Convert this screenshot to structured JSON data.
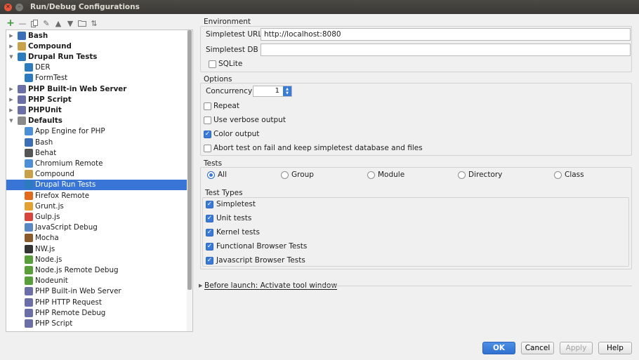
{
  "window": {
    "title": "Run/Debug Configurations"
  },
  "toolbar": {
    "icons": [
      "add-icon",
      "remove-icon",
      "copy-icon",
      "wrench-icon",
      "move-up-icon",
      "move-down-icon",
      "folder-icon",
      "sort-icon"
    ]
  },
  "tree": {
    "items": [
      {
        "label": "Bash",
        "level": 0,
        "arrow": "▶",
        "bold": true,
        "icon": "bash-icon",
        "color": "#3b6fb6"
      },
      {
        "label": "Compound",
        "level": 0,
        "arrow": "▶",
        "bold": true,
        "icon": "compound-icon",
        "color": "#c7a24a"
      },
      {
        "label": "Drupal Run Tests",
        "level": 0,
        "arrow": "▼",
        "bold": true,
        "icon": "drupal-icon",
        "color": "#2c7bbf"
      },
      {
        "label": "DER",
        "level": 1,
        "arrow": "",
        "bold": false,
        "icon": "drupal-icon",
        "color": "#2c7bbf"
      },
      {
        "label": "FormTest",
        "level": 1,
        "arrow": "",
        "bold": false,
        "icon": "drupal-icon",
        "color": "#2c7bbf"
      },
      {
        "label": "PHP Built-in Web Server",
        "level": 0,
        "arrow": "▶",
        "bold": true,
        "icon": "php-server-icon",
        "color": "#6a6fa8"
      },
      {
        "label": "PHP Script",
        "level": 0,
        "arrow": "▶",
        "bold": true,
        "icon": "php-script-icon",
        "color": "#6a6fa8"
      },
      {
        "label": "PHPUnit",
        "level": 0,
        "arrow": "▶",
        "bold": true,
        "icon": "phpunit-icon",
        "color": "#6a6fa8"
      },
      {
        "label": "Defaults",
        "level": 0,
        "arrow": "▼",
        "bold": true,
        "icon": "defaults-icon",
        "color": "#8a8a8a"
      },
      {
        "label": "App Engine for PHP",
        "level": 1,
        "arrow": "",
        "bold": false,
        "icon": "app-engine-icon",
        "color": "#4a8fd8"
      },
      {
        "label": "Bash",
        "level": 1,
        "arrow": "",
        "bold": false,
        "icon": "bash-icon",
        "color": "#3b6fb6"
      },
      {
        "label": "Behat",
        "level": 1,
        "arrow": "",
        "bold": false,
        "icon": "behat-icon",
        "color": "#555555"
      },
      {
        "label": "Chromium Remote",
        "level": 1,
        "arrow": "",
        "bold": false,
        "icon": "chromium-icon",
        "color": "#4d8fd6"
      },
      {
        "label": "Compound",
        "level": 1,
        "arrow": "",
        "bold": false,
        "icon": "compound-icon",
        "color": "#c7a24a"
      },
      {
        "label": "Drupal Run Tests",
        "level": 1,
        "arrow": "",
        "bold": false,
        "icon": "drupal-icon",
        "color": "#2c7bbf",
        "selected": true
      },
      {
        "label": "Firefox Remote",
        "level": 1,
        "arrow": "",
        "bold": false,
        "icon": "firefox-icon",
        "color": "#e06a1d"
      },
      {
        "label": "Grunt.js",
        "level": 1,
        "arrow": "",
        "bold": false,
        "icon": "grunt-icon",
        "color": "#e2a130"
      },
      {
        "label": "Gulp.js",
        "level": 1,
        "arrow": "",
        "bold": false,
        "icon": "gulp-icon",
        "color": "#d9443d"
      },
      {
        "label": "JavaScript Debug",
        "level": 1,
        "arrow": "",
        "bold": false,
        "icon": "js-debug-icon",
        "color": "#5a88c4"
      },
      {
        "label": "Mocha",
        "level": 1,
        "arrow": "",
        "bold": false,
        "icon": "mocha-icon",
        "color": "#8b5a2b"
      },
      {
        "label": "NW.js",
        "level": 1,
        "arrow": "",
        "bold": false,
        "icon": "nwjs-icon",
        "color": "#333333"
      },
      {
        "label": "Node.js",
        "level": 1,
        "arrow": "",
        "bold": false,
        "icon": "nodejs-icon",
        "color": "#5a9e3c"
      },
      {
        "label": "Node.js Remote Debug",
        "level": 1,
        "arrow": "",
        "bold": false,
        "icon": "nodejs-remote-icon",
        "color": "#5a9e3c"
      },
      {
        "label": "Nodeunit",
        "level": 1,
        "arrow": "",
        "bold": false,
        "icon": "nodeunit-icon",
        "color": "#5a9e3c"
      },
      {
        "label": "PHP Built-in Web Server",
        "level": 1,
        "arrow": "",
        "bold": false,
        "icon": "php-server-icon",
        "color": "#6a6fa8"
      },
      {
        "label": "PHP HTTP Request",
        "level": 1,
        "arrow": "",
        "bold": false,
        "icon": "php-http-icon",
        "color": "#6a6fa8"
      },
      {
        "label": "PHP Remote Debug",
        "level": 1,
        "arrow": "",
        "bold": false,
        "icon": "php-remote-icon",
        "color": "#6a6fa8"
      },
      {
        "label": "PHP Script",
        "level": 1,
        "arrow": "",
        "bold": false,
        "icon": "php-script-icon",
        "color": "#6a6fa8"
      }
    ]
  },
  "environment": {
    "title": "Environment",
    "url_label": "Simpletest URL",
    "url_value": "http://localhost:8080",
    "db_label": "Simpletest DB",
    "db_value": "",
    "sqlite_label": "SQLite",
    "sqlite_checked": false
  },
  "options": {
    "title": "Options",
    "concurrency_label": "Concurrency",
    "concurrency_value": "1",
    "repeat_label": "Repeat",
    "verbose_label": "Use verbose output",
    "color_label": "Color output",
    "abort_label": "Abort test on fail and keep simpletest database and files"
  },
  "tests": {
    "title": "Tests",
    "scopes": [
      "All",
      "Group",
      "Module",
      "Directory",
      "Class"
    ],
    "selected_scope": "All",
    "types_title": "Test Types",
    "types": [
      "Simpletest",
      "Unit tests",
      "Kernel tests",
      "Functional Browser Tests",
      "Javascript Browser Tests"
    ]
  },
  "before_launch": {
    "label": "Before launch: Activate tool window"
  },
  "buttons": {
    "ok": "OK",
    "cancel": "Cancel",
    "apply": "Apply",
    "help": "Help"
  },
  "colors": {
    "accent": "#3b7bd8",
    "selection": "#3875d7"
  }
}
